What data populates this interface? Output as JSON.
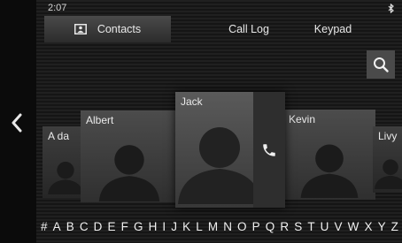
{
  "status": {
    "time": "2:07",
    "bluetooth_icon": "bluetooth-icon"
  },
  "tabs": [
    {
      "label": "Contacts",
      "icon": "contact-book-icon",
      "active": true
    },
    {
      "label": "Call Log",
      "active": false
    },
    {
      "label": "Keypad",
      "active": false
    }
  ],
  "search": {
    "icon": "search-icon"
  },
  "navigation": {
    "back_icon": "chevron-left-icon"
  },
  "contacts": [
    {
      "name": "A da"
    },
    {
      "name": "Albert"
    },
    {
      "name": "Jack",
      "selected": true
    },
    {
      "name": "Kevin"
    },
    {
      "name": "Livy"
    }
  ],
  "call": {
    "icon": "phone-icon"
  },
  "alphabet": [
    "#",
    "A",
    "B",
    "C",
    "D",
    "E",
    "F",
    "G",
    "H",
    "I",
    "J",
    "K",
    "L",
    "M",
    "N",
    "O",
    "P",
    "Q",
    "R",
    "S",
    "T",
    "U",
    "V",
    "W",
    "X",
    "Y",
    "Z"
  ],
  "colors": {
    "background": "#1a1a1a",
    "active_tab": "#4a4a4a",
    "search_button": "#4a4a4a",
    "text": "#e6e6e6"
  }
}
